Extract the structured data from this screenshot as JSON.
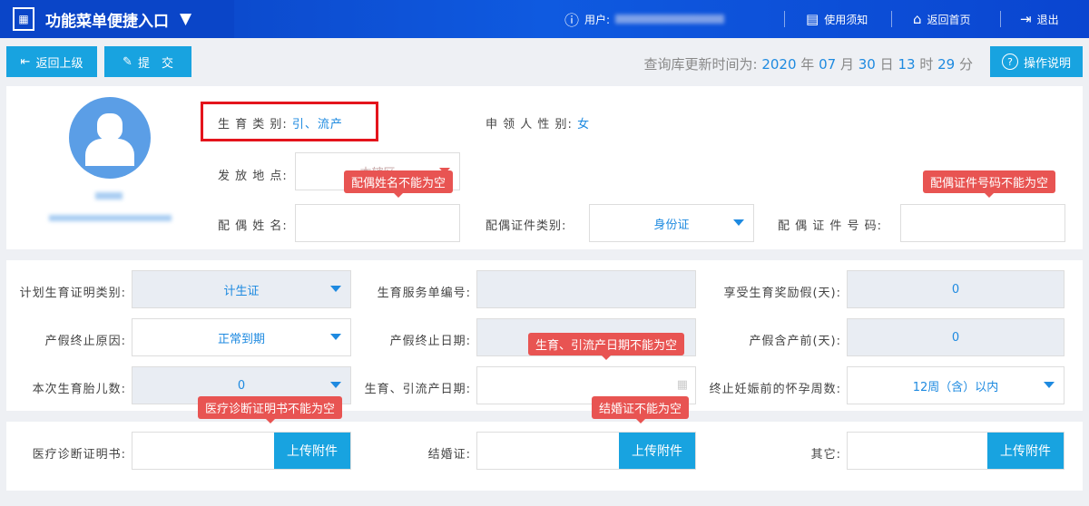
{
  "header": {
    "title": "功能菜单便捷入口",
    "user_label": "用户:",
    "notice": "使用须知",
    "home": "返回首页",
    "logout": "退出"
  },
  "toolbar": {
    "back": "返回上级",
    "submit": "提　交",
    "update_prefix": "查询库更新时间为:",
    "year": "2020",
    "month": "07",
    "day": "30",
    "hour": "13",
    "minute": "29",
    "u_year": "年",
    "u_month": "月",
    "u_day": "日",
    "u_hour": "时",
    "u_minute": "分",
    "help": "操作说明"
  },
  "profile": {
    "birth_type_label": "生 育 类 别:",
    "birth_type": "引、流产",
    "gender_label": "申 领 人 性 别:",
    "gender": "女",
    "place_label": "发 放 地 点:",
    "place_value": "本辖区",
    "spouse_name_label": "配 偶 姓 名:",
    "spouse_name_error": "配偶姓名不能为空",
    "spouse_id_type_label": "配偶证件类别:",
    "spouse_id_type": "身份证",
    "spouse_id_no_label": "配 偶 证 件 号 码:",
    "spouse_id_no_error": "配偶证件号码不能为空"
  },
  "form": {
    "plan_cert_label": "计划生育证明类别:",
    "plan_cert": "计生证",
    "service_no_label": "生育服务单编号:",
    "reward_leave_label": "享受生育奖励假(天):",
    "reward_leave": "0",
    "end_reason_label": "产假终止原因:",
    "end_reason": "正常到期",
    "end_date_label": "产假终止日期:",
    "prenatal_label": "产假含产前(天):",
    "prenatal": "0",
    "fetus_count_label": "本次生育胎儿数:",
    "fetus_count": "0",
    "birth_date_label": "生育、引流产日期:",
    "birth_date_error": "生育、引流产日期不能为空",
    "weeks_label": "终止妊娠前的怀孕周数:",
    "weeks": "12周（含）以内"
  },
  "attachments": {
    "medical_label": "医疗诊断证明书:",
    "medical_error": "医疗诊断证明书不能为空",
    "marriage_label": "结婚证:",
    "marriage_error": "结婚证不能为空",
    "other_label": "其它:",
    "upload": "上传附件"
  }
}
